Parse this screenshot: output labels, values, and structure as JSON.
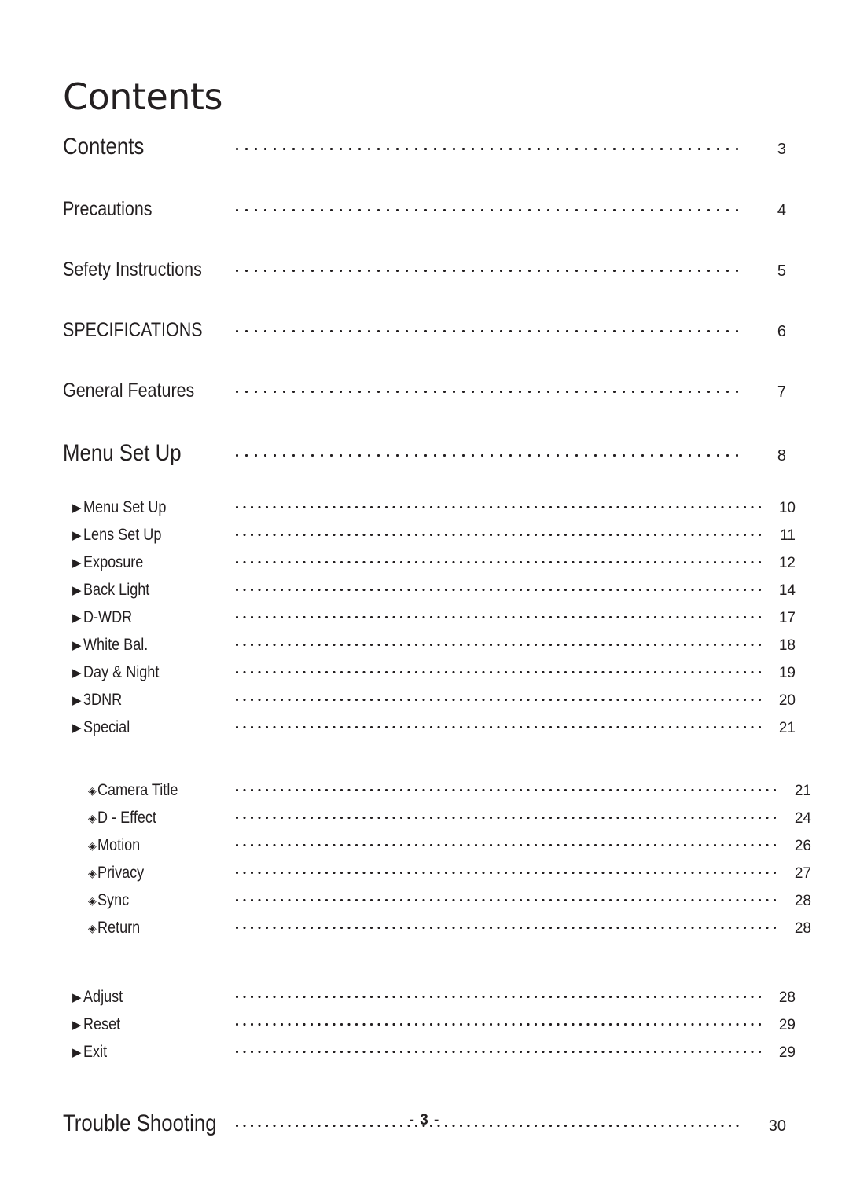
{
  "document": {
    "page_title": "Contents",
    "footer": "- 3 -"
  },
  "icons": {
    "triangle": "▶",
    "diamond": "◈"
  },
  "toc": {
    "majors": [
      {
        "label": "Contents",
        "page": "3"
      },
      {
        "label": "Precautions",
        "page": "4"
      },
      {
        "label": "Sefety Instructions",
        "page": "5"
      },
      {
        "label": "SPECIFICATIONS",
        "page": "6"
      },
      {
        "label": "General Features",
        "page": "7"
      },
      {
        "label": "Menu Set Up",
        "page": "8"
      }
    ],
    "subs": [
      {
        "label": "Menu Set Up",
        "page": "10"
      },
      {
        "label": "Lens Set Up",
        "page": "11"
      },
      {
        "label": "Exposure",
        "page": "12"
      },
      {
        "label": "Back Light",
        "page": "14"
      },
      {
        "label": "D-WDR",
        "page": "17"
      },
      {
        "label": "White Bal.",
        "page": "18"
      },
      {
        "label": "Day & Night",
        "page": "19"
      },
      {
        "label": "3DNR",
        "page": "20"
      },
      {
        "label": "Special",
        "page": "21"
      }
    ],
    "subsubs": [
      {
        "label": "Camera Title",
        "page": "21"
      },
      {
        "label": "D - Effect",
        "page": "24"
      },
      {
        "label": "Motion",
        "page": "26"
      },
      {
        "label": "Privacy",
        "page": "27"
      },
      {
        "label": "Sync",
        "page": "28"
      },
      {
        "label": "Return",
        "page": "28"
      }
    ],
    "tail": [
      {
        "label": "Adjust",
        "page": "28"
      },
      {
        "label": "Reset",
        "page": "29"
      },
      {
        "label": "Exit",
        "page": "29"
      }
    ],
    "last": {
      "label": "Trouble Shooting",
      "page": "30"
    }
  }
}
